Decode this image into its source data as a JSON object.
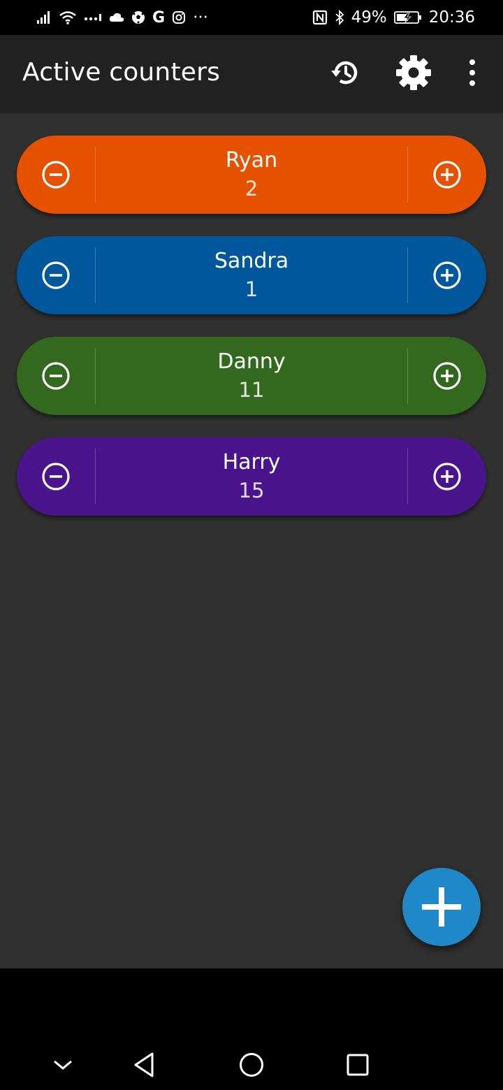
{
  "status_bar": {
    "carrier_glyph": "G",
    "more_glyph": "···",
    "battery": "49%",
    "time": "20:36",
    "icons": [
      "signal-icon",
      "wifi-icon",
      "data-dots-icon",
      "cloud-icon",
      "soccer-ball-icon",
      "google-icon",
      "instagram-icon",
      "more-notifications-icon",
      "nfc-icon",
      "bluetooth-icon",
      "battery-icon"
    ]
  },
  "app_bar": {
    "title": "Active counters",
    "actions": [
      "history-icon",
      "settings-icon",
      "more-vert-icon"
    ]
  },
  "counters": [
    {
      "name": "Ryan",
      "value": "2",
      "color": "#E65100"
    },
    {
      "name": "Sandra",
      "value": "1",
      "color": "#01579B"
    },
    {
      "name": "Danny",
      "value": "11",
      "color": "#33691E"
    },
    {
      "name": "Harry",
      "value": "15",
      "color": "#4A148C"
    }
  ],
  "fab": {
    "icon": "add-icon",
    "color": "#1E88C9"
  },
  "nav_bar": {
    "icons": [
      "hide-nav-icon",
      "back-icon",
      "home-icon",
      "recents-icon"
    ]
  }
}
